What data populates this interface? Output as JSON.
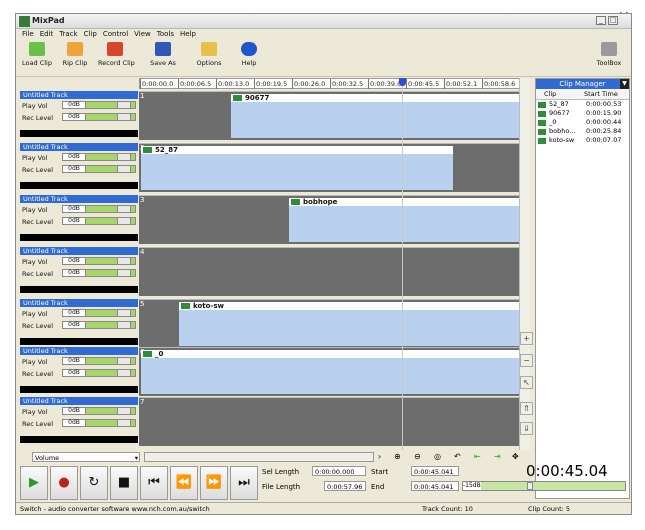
{
  "window": {
    "title": "MixPad"
  },
  "menu": [
    "File",
    "Edit",
    "Track",
    "Clip",
    "Control",
    "View",
    "Tools",
    "Help"
  ],
  "toolbar": {
    "buttons": [
      {
        "label": "Load Clip",
        "icon": "load-clip-icon"
      },
      {
        "label": "Rip Clip",
        "icon": "rip-clip-icon"
      },
      {
        "label": "Record Clip",
        "icon": "record-clip-icon"
      },
      {
        "label": "Save As",
        "icon": "save-icon"
      },
      {
        "label": "Options",
        "icon": "options-icon"
      },
      {
        "label": "Help",
        "icon": "help-icon"
      }
    ],
    "toolbox_label": "ToolBox"
  },
  "ruler": {
    "ticks": [
      "0:00:00.0",
      "0:00:06.5",
      "0:00:13.0",
      "0:00:19.5",
      "0:00:26.0",
      "0:00:32.5",
      "0:00:39.0",
      "0:00:45.5",
      "0:00:52.1",
      "0:00:58.6"
    ]
  },
  "tracks": [
    {
      "name": "Untitled Track",
      "play_label": "Play Vol",
      "rec_label": "Rec Level",
      "play_db": "0dB",
      "rec_db": "0dB",
      "number": "1",
      "clip": "90677"
    },
    {
      "name": "Untitled Track",
      "play_label": "Play Vol",
      "rec_label": "Rec Level",
      "play_db": "0dB",
      "rec_db": "0dB",
      "number": "2",
      "clip": "52_87"
    },
    {
      "name": "Untitled Track",
      "play_label": "Play Vol",
      "rec_label": "Rec Level",
      "play_db": "0dB",
      "rec_db": "0dB",
      "number": "3",
      "clip": "bobhope"
    },
    {
      "name": "Untitled Track",
      "play_label": "Play Vol",
      "rec_label": "Rec Level",
      "play_db": "0dB",
      "rec_db": "0dB",
      "number": "4",
      "clip": ""
    },
    {
      "name": "Untitled Track",
      "play_label": "Play Vol",
      "rec_label": "Rec Level",
      "play_db": "0dB",
      "rec_db": "0dB",
      "number": "5",
      "clip": "koto-sw"
    },
    {
      "name": "Untitled Track",
      "play_label": "Play Vol",
      "rec_label": "Rec Level",
      "play_db": "0dB",
      "rec_db": "0dB",
      "number": "6",
      "clip": "_0"
    },
    {
      "name": "Untitled Track",
      "play_label": "Play Vol",
      "rec_label": "Rec Level",
      "play_db": "0dB",
      "rec_db": "0dB",
      "number": "7",
      "clip": ""
    }
  ],
  "clip_manager": {
    "title": "Clip Manager",
    "col_clip": "Clip",
    "col_start": "Start Time",
    "items": [
      {
        "name": "52_87",
        "start": "0:00:00.53"
      },
      {
        "name": "90677",
        "start": "0:00:15.90"
      },
      {
        "name": "_0",
        "start": "0:00:00.44"
      },
      {
        "name": "bobho...",
        "start": "0:00:25.84"
      },
      {
        "name": "koto-sw",
        "start": "0:00:07.07"
      }
    ]
  },
  "bottom": {
    "volume_select": "Volume"
  },
  "transport": {
    "sel_length_label": "Sel Length",
    "sel_length": "0:00:00.000",
    "start_label": "Start",
    "start": "0:00:45.041",
    "file_length_label": "File Length",
    "file_length": "0:00:57.96",
    "end_label": "End",
    "end": "0:00:45.041",
    "level": "-15dB",
    "time": "0:00:45.04"
  },
  "status": {
    "text": "Switch - audio converter software www.nch.com.au/switch",
    "track_count": "Track Count: 10",
    "clip_count": "Clip Count: 5"
  }
}
